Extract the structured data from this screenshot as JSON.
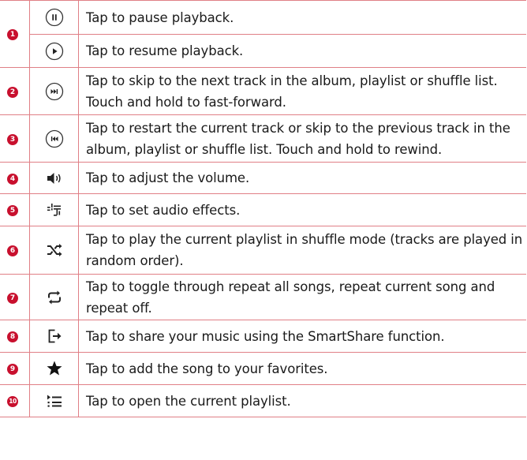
{
  "rows": [
    {
      "num": "1",
      "text": "Tap to pause playback.",
      "icon": "pause-circle-icon"
    },
    {
      "num": "",
      "text": "Tap to resume playback.",
      "icon": "play-circle-icon"
    },
    {
      "num": "2",
      "text": "Tap to skip to the next track in the album, playlist or shuffle list. Touch and hold to fast-forward.",
      "icon": "skip-next-circle-icon"
    },
    {
      "num": "3",
      "text": "Tap to restart the current track or skip to the previous track in the album, playlist or shuffle list. Touch and hold to rewind.",
      "icon": "skip-previous-circle-icon"
    },
    {
      "num": "4",
      "text": "Tap to adjust the volume.",
      "icon": "volume-icon"
    },
    {
      "num": "5",
      "text": "Tap to set audio effects.",
      "icon": "audio-effects-icon"
    },
    {
      "num": "6",
      "text": "Tap to play the current playlist in shuffle mode (tracks are played in random order).",
      "icon": "shuffle-icon"
    },
    {
      "num": "7",
      "text": "Tap to toggle through repeat all songs, repeat current song and repeat off.",
      "icon": "repeat-icon"
    },
    {
      "num": "8",
      "text": "Tap to share your music using the SmartShare function.",
      "icon": "share-icon"
    },
    {
      "num": "9",
      "text": "Tap to add the song to your favorites.",
      "icon": "star-icon"
    },
    {
      "num": "10",
      "text": "Tap to open the current playlist.",
      "icon": "playlist-icon"
    }
  ],
  "colors": {
    "border": "#e07f86",
    "badge": "#c8102e",
    "text": "#1a1a1a"
  }
}
